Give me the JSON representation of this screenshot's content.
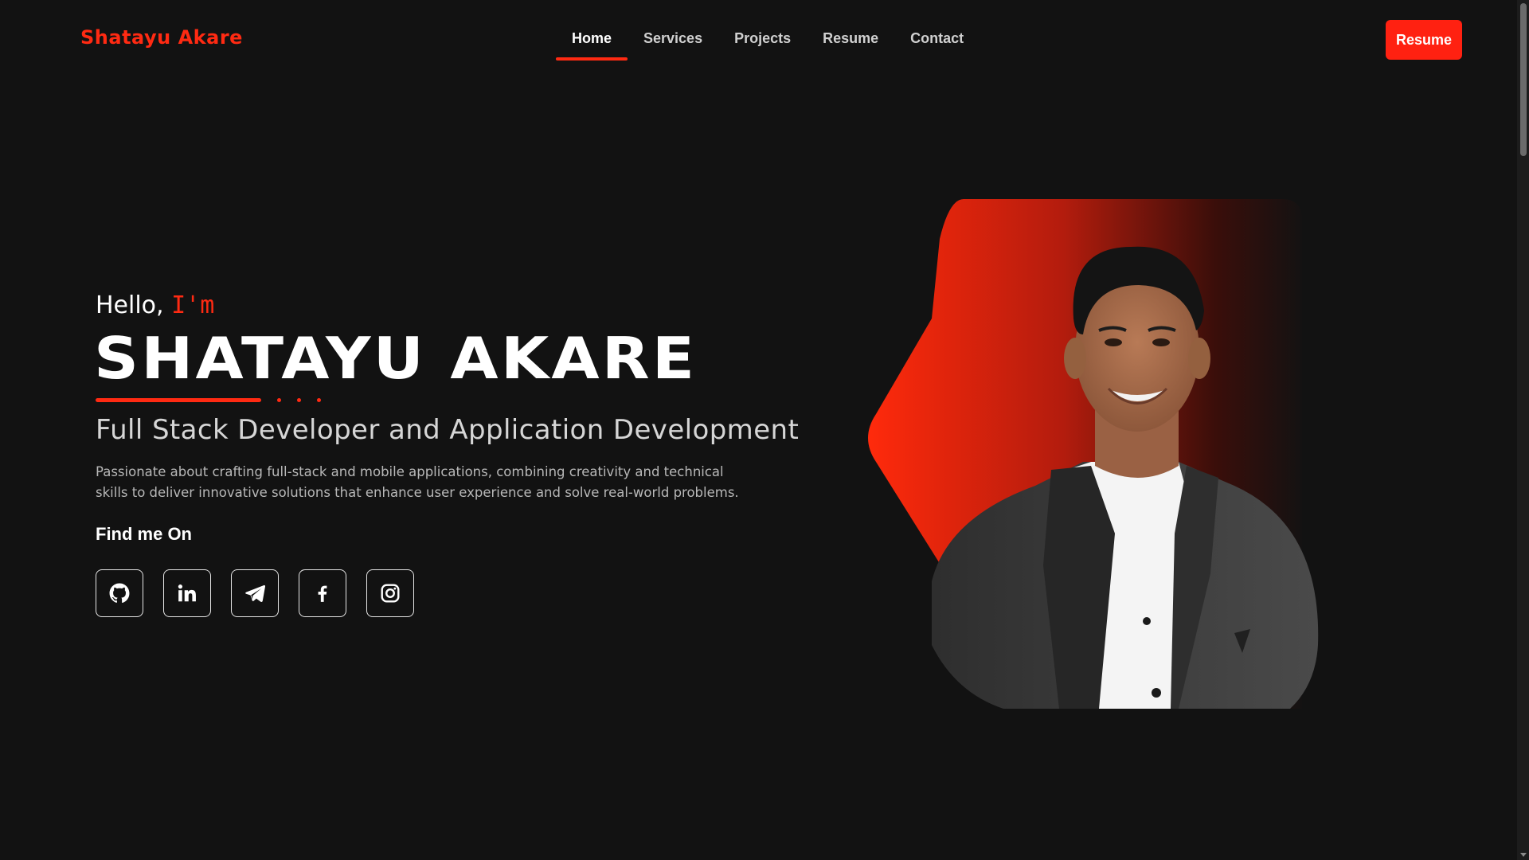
{
  "header": {
    "brand": "Shatayu Akare",
    "nav": [
      {
        "label": "Home",
        "active": true
      },
      {
        "label": "Services",
        "active": false
      },
      {
        "label": "Projects",
        "active": false
      },
      {
        "label": "Resume",
        "active": false
      },
      {
        "label": "Contact",
        "active": false
      }
    ],
    "cta_label": "Resume"
  },
  "hero": {
    "greeting": "Hello,",
    "greeting_accent": "I'm",
    "name": "SHATAYU AKARE",
    "role": "Full Stack Developer and Application Development",
    "bio_line1": "Passionate about crafting full-stack and mobile applications, combining creativity and technical",
    "bio_line2": "skills to deliver innovative solutions that enhance user experience and solve real-world problems.",
    "find_me_label": "Find me On",
    "socials": [
      {
        "icon": "github-icon"
      },
      {
        "icon": "linkedin-icon"
      },
      {
        "icon": "telegram-icon"
      },
      {
        "icon": "facebook-icon"
      },
      {
        "icon": "instagram-icon"
      }
    ]
  },
  "colors": {
    "accent": "#ff2a12",
    "background": "#121212",
    "text": "#ffffff",
    "muted_text": "#b8b8b8"
  }
}
